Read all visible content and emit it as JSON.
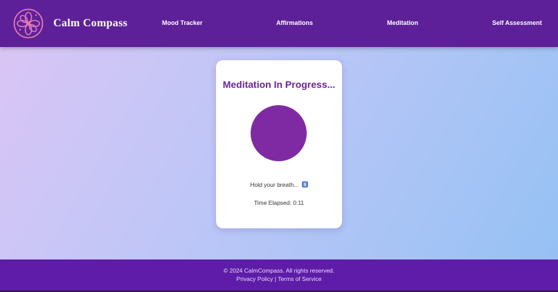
{
  "header": {
    "brand": "Calm Compass",
    "logo_icon": "flower-logo-icon",
    "nav": [
      {
        "label": "Mood Tracker"
      },
      {
        "label": "Affirmations"
      },
      {
        "label": "Meditation"
      },
      {
        "label": "Self Assessment"
      }
    ]
  },
  "meditation": {
    "title": "Meditation In Progress...",
    "instruction": "Hold your breath...",
    "instruction_icon": "pause-icon",
    "elapsed_label": "Time Elapsed:",
    "elapsed_value": "0:11"
  },
  "footer": {
    "copyright": "© 2024 CalmCompass. All rights reserved.",
    "privacy": "Privacy Policy",
    "separator": "|",
    "terms": "Terms of Service"
  },
  "colors": {
    "header_bg": "#5e2098",
    "footer_bg": "#5e1ca8",
    "accent": "#6a2395",
    "breath_circle": "#7f2aa3",
    "logo": "#e07ab8"
  }
}
